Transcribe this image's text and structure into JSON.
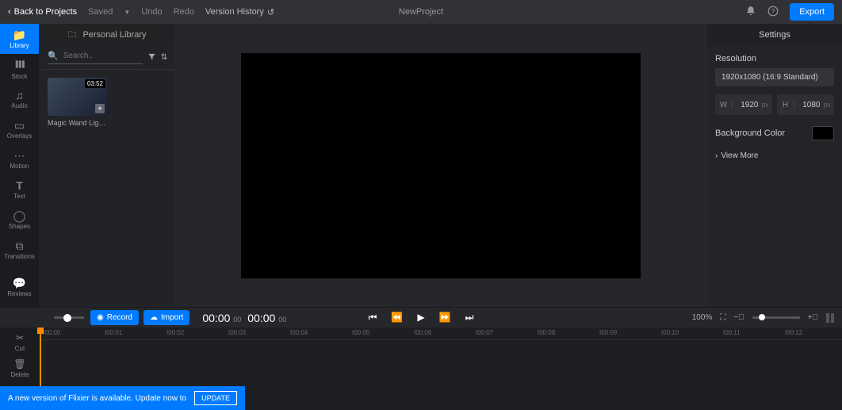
{
  "topbar": {
    "back": "Back to Projects",
    "saved": "Saved",
    "undo": "Undo",
    "redo": "Redo",
    "version_history": "Version History",
    "project_title": "NewProject",
    "export": "Export"
  },
  "sidebar": {
    "items": [
      {
        "label": "Library"
      },
      {
        "label": "Stock"
      },
      {
        "label": "Audio"
      },
      {
        "label": "Overlays"
      },
      {
        "label": "Motion"
      },
      {
        "label": "Text"
      },
      {
        "label": "Shapes"
      },
      {
        "label": "Transitions"
      }
    ],
    "reviews": "Reviews"
  },
  "library": {
    "header": "Personal Library",
    "search_placeholder": "Search..",
    "clip": {
      "duration": "03:52",
      "label": "Magic Wand Light..."
    }
  },
  "controls": {
    "record": "Record",
    "import": "Import",
    "time_current": "00:00",
    "time_current_ms": "00",
    "time_total": "00:00",
    "time_total_ms": "00",
    "zoom": "100%"
  },
  "timeline": {
    "ticks": [
      "I00:00",
      "I00:01",
      "I00:02",
      "I00:03",
      "I00:04",
      "I00:05",
      "I00:06",
      "I00:07",
      "I00:08",
      "I00:09",
      "I00:10",
      "I00:11",
      "I00:12"
    ],
    "tools": [
      {
        "label": "Cut"
      },
      {
        "label": "Delete"
      }
    ]
  },
  "settings": {
    "title": "Settings",
    "resolution_label": "Resolution",
    "resolution_value": "1920x1080 (16:9 Standard)",
    "width_label": "W",
    "width": "1920",
    "width_unit": "px",
    "height_label": "H",
    "height": "1080",
    "height_unit": "px",
    "bg_label": "Background Color",
    "view_more": "View More"
  },
  "update": {
    "text": "A new version of Flixier is available. Update now to",
    "button": "UPDATE"
  }
}
